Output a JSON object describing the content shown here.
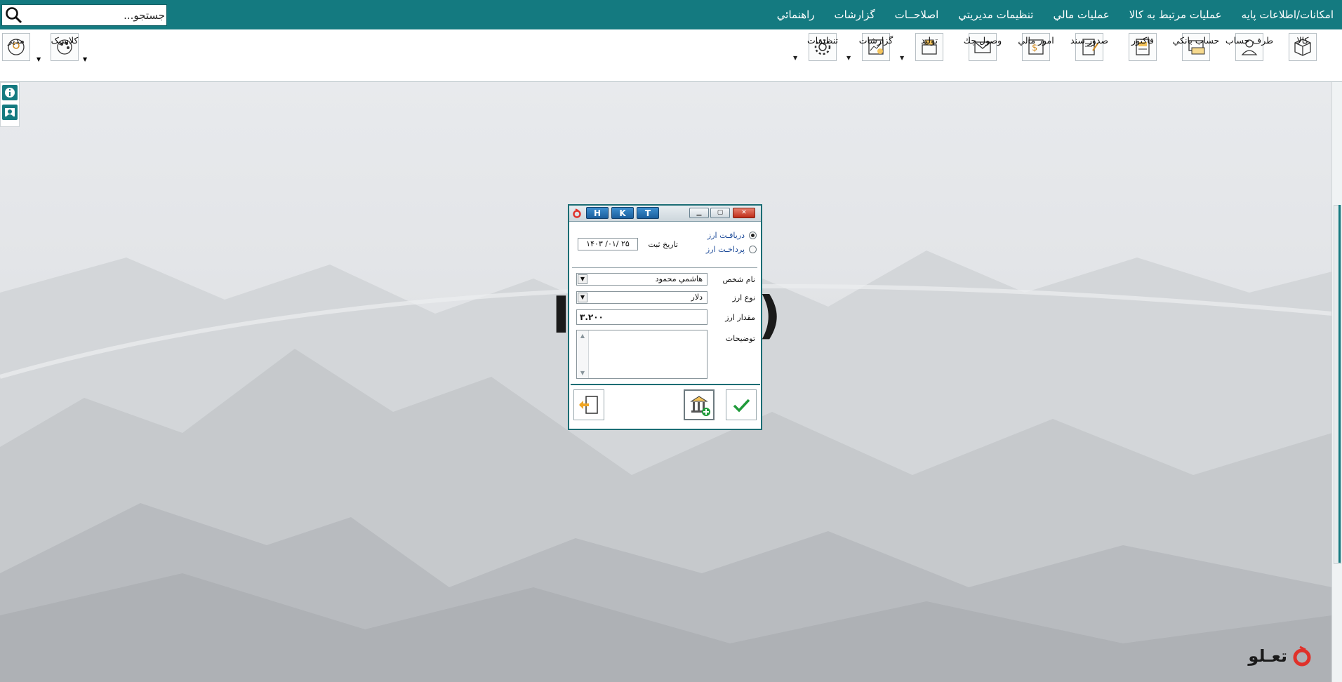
{
  "menubar": {
    "search_placeholder": "جستجو...",
    "items": [
      "امکانات/اطلاعات پایه",
      "عملیات مرتبط به کالا",
      "عملیات مالي",
      "تنظیمات مدیریتي",
      "اصلاحــات",
      "گزارشات",
      "راهنمائي"
    ]
  },
  "toolbar": {
    "right_items": [
      "کالا",
      "طرف حساب",
      "حساب بانکي",
      "فاکتور",
      "صدور سند",
      "امور مالي",
      "وصول چك",
      "تولید",
      "گزارشات",
      "تنظیمات"
    ],
    "left_items": [
      "مدیر",
      "کلاسیک"
    ]
  },
  "dialog": {
    "title_buttons": [
      "H",
      "K",
      "T"
    ],
    "radio_receive": "دریافـت ارز",
    "radio_pay": "پرداخـت ارز",
    "date_label": "تاریخ ثبت",
    "date_value": "۱۴۰۳ /۰۱/ ۲۵",
    "person_label": "نام شخص",
    "person_value": "هاشمي محمود",
    "currency_label": "نوع ارز",
    "currency_value": "دلار",
    "amount_label": "مقدار ارز",
    "amount_value": "۳.۲۰۰",
    "notes_label": "توضیحات",
    "notes_value": ""
  },
  "brand": {
    "logo_text": "تعـلو",
    "accent": "#147a80",
    "logo_red": "#e0312a"
  }
}
